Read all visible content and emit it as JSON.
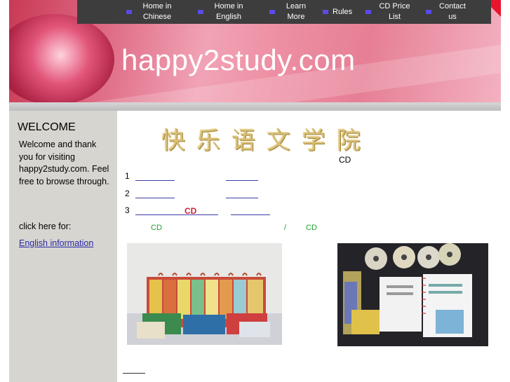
{
  "nav": {
    "items": [
      {
        "label": "Home in Chinese"
      },
      {
        "label": "Home in English"
      },
      {
        "label": "Learn More"
      },
      {
        "label": "Rules"
      },
      {
        "label": "CD Price List"
      },
      {
        "label": "Contact us"
      }
    ]
  },
  "banner": {
    "title": "happy2study.com"
  },
  "sidebar": {
    "heading": "WELCOME",
    "text": "Welcome and thank you for visiting happy2study.com. Feel free to browse through.",
    "click_text": "click here for:",
    "link_label": "English information"
  },
  "main": {
    "chinese_title": "快乐语文学院",
    "cd_label": "CD",
    "rows": [
      {
        "num": "1"
      },
      {
        "num": "2"
      },
      {
        "num": "3",
        "cd": "CD"
      }
    ],
    "green_left": "CD",
    "green_slash": "/",
    "green_right": "CD"
  },
  "colors": {
    "nav_bg": "#3d3d3d",
    "nav_bullet": "#5a4be6",
    "banner_pink": "#e67f95",
    "sidebar_bg": "#d7d5cf",
    "link": "#2a2aa8",
    "green_text": "#22a030",
    "red_text": "#cc2233"
  }
}
